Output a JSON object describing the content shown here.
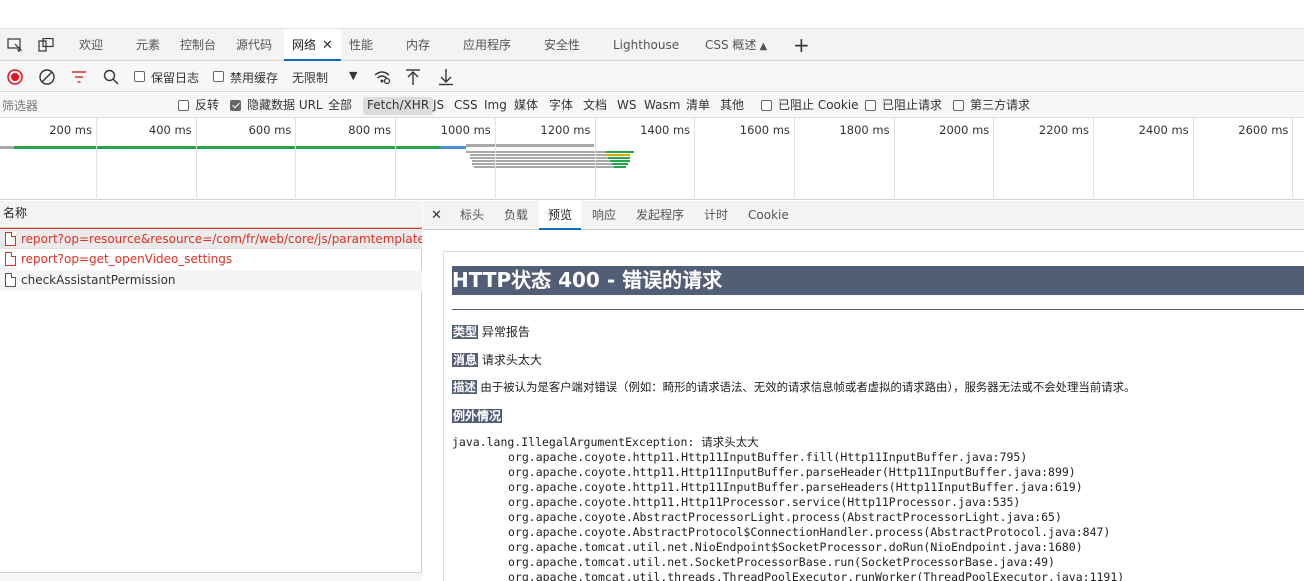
{
  "tabs": [
    {
      "label": "欢迎"
    },
    {
      "label": "元素"
    },
    {
      "label": "控制台"
    },
    {
      "label": "源代码"
    },
    {
      "label": "网络",
      "close": "✕"
    },
    {
      "label": "性能"
    },
    {
      "label": "内存"
    },
    {
      "label": "应用程序"
    },
    {
      "label": "安全性"
    },
    {
      "label": "Lighthouse"
    },
    {
      "label": "CSS 概述"
    }
  ],
  "toolbar": {
    "preserve_log": "保留日志",
    "disable_cache": "禁用缓存",
    "throttle": "无限制"
  },
  "filter": {
    "placeholder": "筛选器",
    "invert": "反转",
    "hide_data_urls": "隐藏数据 URL",
    "types": [
      "全部",
      "Fetch/XHR",
      "JS",
      "CSS",
      "Img",
      "媒体",
      "字体",
      "文档",
      "WS",
      "Wasm",
      "清单",
      "其他"
    ],
    "blocked_cookies": "已阻止 Cookie",
    "blocked_requests": "已阻止请求",
    "third_party": "第三方请求"
  },
  "timeline": {
    "ticks": [
      "200 ms",
      "400 ms",
      "600 ms",
      "800 ms",
      "1000 ms",
      "1200 ms",
      "1400 ms",
      "1600 ms",
      "1800 ms",
      "2000 ms",
      "2200 ms",
      "2400 ms",
      "2600 ms"
    ]
  },
  "requests": {
    "column_name": "名称",
    "rows": [
      {
        "name": "report?op=resource&resource=/com/fr/web/core/js/paramtemplate.js",
        "error": true
      },
      {
        "name": "report?op=get_openVideo_settings",
        "error": true
      },
      {
        "name": "checkAssistantPermission",
        "error": false
      }
    ]
  },
  "detail": {
    "close": "✕",
    "tabs": [
      "标头",
      "负载",
      "预览",
      "响应",
      "发起程序",
      "计时",
      "Cookie"
    ],
    "active_tab": "预览"
  },
  "preview": {
    "title": "HTTP状态 400 - 错误的请求",
    "type_label": "类型",
    "type_value": "异常报告",
    "message_label": "消息",
    "message_value": "请求头太大",
    "desc_label": "描述",
    "desc_value": "由于被认为是客户端对错误（例如：畸形的请求语法、无效的请求信息帧或者虚拟的请求路由），服务器无法或不会处理当前请求。",
    "exception_label": "例外情况",
    "stack": [
      "java.lang.IllegalArgumentException: 请求头太大",
      "\torg.apache.coyote.http11.Http11InputBuffer.fill(Http11InputBuffer.java:795)",
      "\torg.apache.coyote.http11.Http11InputBuffer.parseHeader(Http11InputBuffer.java:899)",
      "\torg.apache.coyote.http11.Http11InputBuffer.parseHeaders(Http11InputBuffer.java:619)",
      "\torg.apache.coyote.http11.Http11Processor.service(Http11Processor.java:535)",
      "\torg.apache.coyote.AbstractProcessorLight.process(AbstractProcessorLight.java:65)",
      "\torg.apache.coyote.AbstractProtocol$ConnectionHandler.process(AbstractProtocol.java:847)",
      "\torg.apache.tomcat.util.net.NioEndpoint$SocketProcessor.doRun(NioEndpoint.java:1680)",
      "\torg.apache.tomcat.util.net.SocketProcessorBase.run(SocketProcessorBase.java:49)",
      "\torg.apache.tomcat.util.threads.ThreadPoolExecutor.runWorker(ThreadPoolExecutor.java:1191)"
    ]
  },
  "colors": {
    "accent": "#0f6cbd",
    "error": "#d93025",
    "tomcat_header": "#525d76",
    "record": "#e81123"
  }
}
